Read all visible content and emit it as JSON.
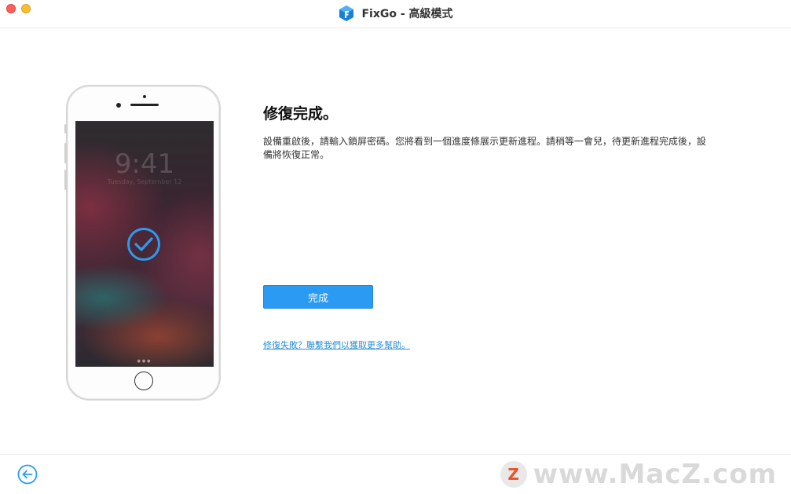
{
  "window": {
    "title": "FixGo - 高級模式",
    "app_icon": "fixgo-logo-icon",
    "accent": "#2b9af3"
  },
  "phone": {
    "lock_time": "9:41",
    "lock_date": "Tuesday, September 12",
    "status_icon": "check-circle-icon"
  },
  "main": {
    "heading": "修復完成。",
    "description": "設備重啟後，請輸入鎖屏密碼。您將看到一個進度條展示更新進程。請稍等一會兒，待更新進程完成後，設備將恢復正常。",
    "done_button": "完成",
    "help_link": "修復失敗？聯繫我們以獲取更多幫助。"
  },
  "footer": {
    "back_icon": "back-arrow-icon"
  },
  "watermark": {
    "badge": "Z",
    "text": "www.MacZ.com"
  }
}
